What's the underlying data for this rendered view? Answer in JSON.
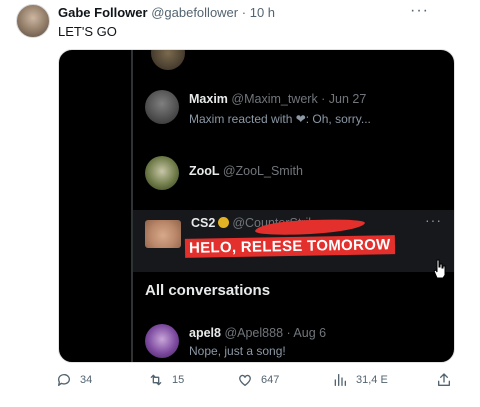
{
  "tweet": {
    "author_name": "Gabe Follower",
    "author_handle": "@gabefollower",
    "separator": "·",
    "time": "10 h",
    "text": "LET'S GO",
    "more_icon": "more-horizontal-icon"
  },
  "media": {
    "rows": [
      {
        "name": "Maxim",
        "sub": "@Maxim_twerk · Jun 27",
        "message": "Maxim reacted with ❤: Oh, sorry..."
      },
      {
        "name": "ZooL",
        "sub": "@ZooL_Smith",
        "message": ""
      },
      {
        "name": "CS2",
        "sub": "@CounterStrike",
        "message": ""
      },
      {
        "name": "apel8",
        "sub": "@Apel888 · Aug 6",
        "message": "Nope, just a song!"
      }
    ],
    "banner_text": "HELO, RELESE TOMOROW",
    "section_title": "All conversations"
  },
  "actions": {
    "replies": "34",
    "retweets": "15",
    "likes": "647",
    "views": "31,4 E"
  }
}
